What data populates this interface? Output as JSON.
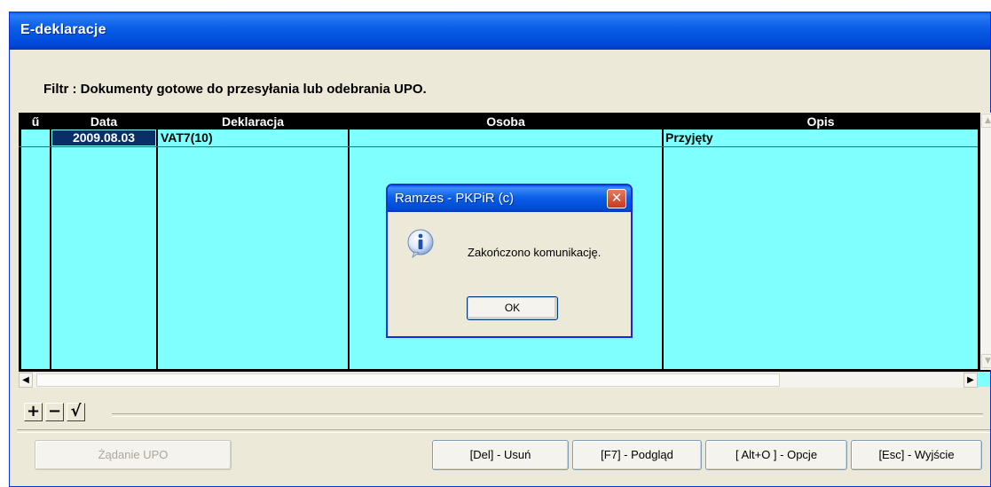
{
  "window": {
    "title": "E-deklaracje"
  },
  "filter": {
    "text": "Filtr : Dokumenty gotowe do przesyłania lub odebrania UPO."
  },
  "table": {
    "columns": [
      "ű",
      "Data",
      "Deklaracja",
      "Osoba",
      "Opis"
    ],
    "rows": [
      {
        "marker": "",
        "date": "2009.08.03",
        "declaration": "VAT7(10)",
        "person": "",
        "description": "Przyjęty"
      }
    ]
  },
  "nav": {
    "add": "+",
    "remove": "−",
    "confirm": "√"
  },
  "buttons": {
    "upo": "Żądanie UPO",
    "delete": "[Del] - Usuń",
    "preview": "[F7] - Podgląd",
    "options": "[ Alt+O ] - Opcje",
    "exit": "[Esc] - Wyjście"
  },
  "dialog": {
    "title": "Ramzes - PKPiR (c)",
    "message": "Zakończono komunikację.",
    "ok": "OK"
  },
  "colors": {
    "grid_bg": "#7ffffe",
    "title_blue": "#0a5fe8",
    "selected_cell": "#0a2f66"
  }
}
